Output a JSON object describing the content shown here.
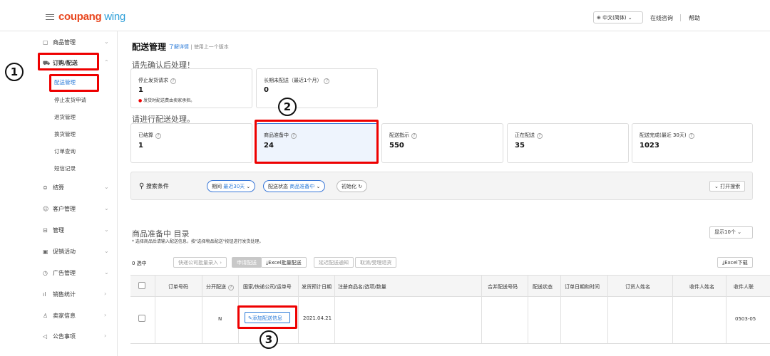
{
  "header": {
    "logo_main": "coupang",
    "logo_wing": " wing",
    "language": "中文(简体)",
    "consult": "在线咨询",
    "help": "帮助"
  },
  "sidebar": {
    "items": [
      {
        "label": "商品管理",
        "icon": "box-icon"
      },
      {
        "label": "订购/配送",
        "icon": "truck-icon"
      },
      {
        "label": "结算",
        "icon": "coin-icon"
      },
      {
        "label": "客户管理",
        "icon": "smile-icon"
      },
      {
        "label": "管理",
        "icon": "folder-icon"
      },
      {
        "label": "促销活动",
        "icon": "promo-icon"
      },
      {
        "label": "广告管理",
        "icon": "ad-icon"
      },
      {
        "label": "销售统计",
        "icon": "chart-icon"
      },
      {
        "label": "卖家信息",
        "icon": "person-icon"
      },
      {
        "label": "公告事项",
        "icon": "speaker-icon"
      }
    ],
    "subitems": [
      "配送管理",
      "停止发货申请",
      "退货管理",
      "换货管理",
      "订单查询",
      "短信记录"
    ]
  },
  "page": {
    "title": "配送管理",
    "link_detail": "了解详情",
    "link_prev": "使用上一个版本",
    "section1": "请先确认后处理！",
    "section2": "请进行配送处理。"
  },
  "cards1": [
    {
      "label": "停止发货请求",
      "value": "1",
      "note": "发货时配送费由卖家承担。"
    },
    {
      "label": "长期未配送（最近1个月）",
      "value": "0"
    }
  ],
  "cards2": [
    {
      "label": "已结算",
      "value": "1"
    },
    {
      "label": "商品准备中",
      "value": "24"
    },
    {
      "label": "配送指示",
      "value": "550"
    },
    {
      "label": "正在配送",
      "value": "35"
    },
    {
      "label": "配送完成(最近 30天)",
      "value": "1023"
    }
  ],
  "search": {
    "label": "搜索条件",
    "pill1_k": "期间",
    "pill1_v": "最近30天",
    "pill2_k": "配送状态",
    "pill2_v": "商品准备中",
    "reset": "初始化",
    "open": "打开搜索"
  },
  "list": {
    "title": "商品准备中 目录",
    "hint": "* 选择商品后请输入配送信息，按\"选择物品配送\"按钮进行发货处理。",
    "page_size": "显示10个",
    "selected": "0 选中",
    "actions": [
      "快递公司批量录入",
      "申请配送",
      "Excel批量配送",
      "延迟配送通知",
      "取消/受理退货"
    ],
    "excel_download": "Excel下载"
  },
  "table": {
    "columns": [
      "订单号码",
      "分开配送",
      "国家/快递公司/运单号",
      "发货预计日期",
      "注册商品名/选项/数量",
      "合并配送号码",
      "配送状态",
      "订单日期和时间",
      "订货人姓名",
      "收件人姓名",
      "收件人联"
    ],
    "row": {
      "split": "N",
      "add_button": "添加配送信息",
      "date": "2021.04.21",
      "phone": "0503-05"
    }
  },
  "annotations": [
    "1",
    "2",
    "3"
  ],
  "colors": {
    "accent": "#2a7ad8",
    "annotation": "#e00000",
    "brand": "#e8461e"
  }
}
